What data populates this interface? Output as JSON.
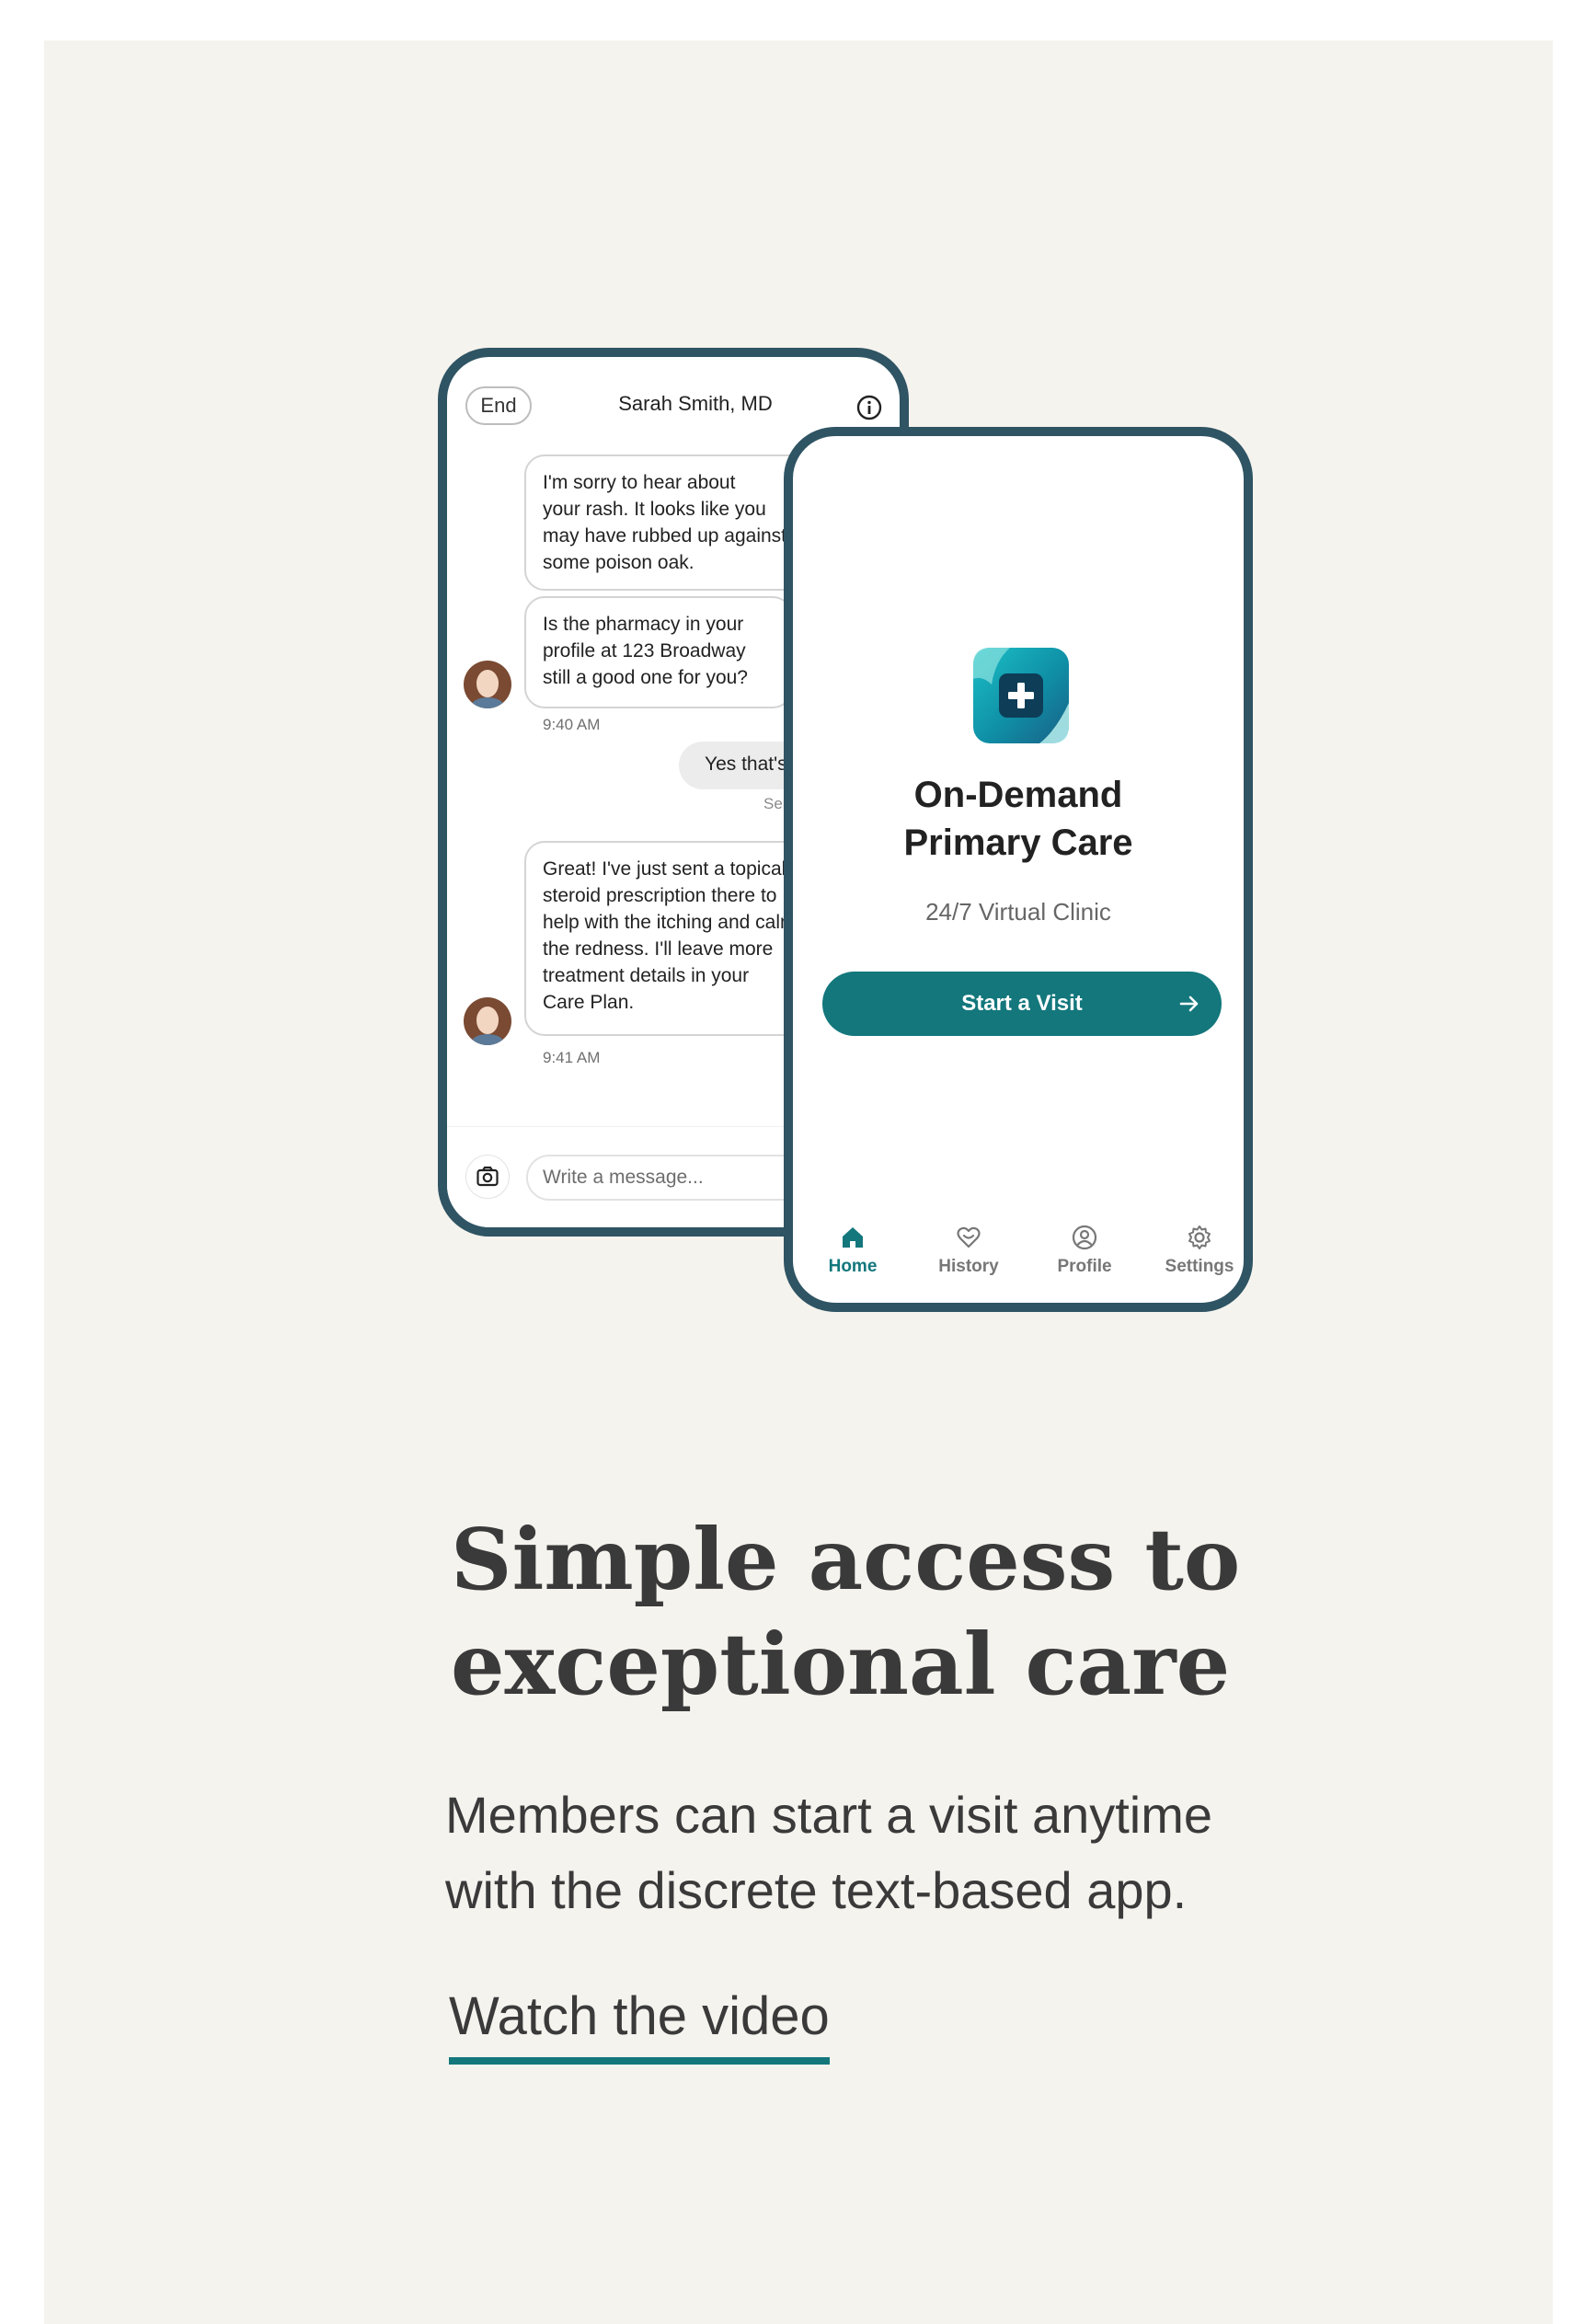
{
  "chat_phone": {
    "end_label": "End",
    "doctor_name": "Sarah Smith, MD",
    "messages": [
      {
        "lines": [
          "I'm sorry to hear about",
          "your rash. It looks like you",
          "may have rubbed up against",
          "some poison oak."
        ]
      },
      {
        "lines": [
          "Is the pharmacy in your",
          "profile at 123 Broadway",
          "still a good one for you?"
        ],
        "time": "9:40 AM"
      },
      {
        "text": "Yes that's",
        "status": "Sent"
      },
      {
        "lines": [
          "Great! I've just sent a topical",
          "steroid prescription there to",
          "help with the itching and calm",
          "the redness. I'll leave more",
          "treatment details in your",
          "Care Plan."
        ],
        "time": "9:41 AM"
      }
    ],
    "composer_placeholder": "Write a message..."
  },
  "home_phone": {
    "title_line1": "On-Demand",
    "title_line2": "Primary Care",
    "subtitle": "24/7 Virtual Clinic",
    "cta_label": "Start a Visit",
    "tabs": [
      {
        "label": "Home",
        "icon": "home-icon",
        "active": true
      },
      {
        "label": "History",
        "icon": "heart-chat-icon",
        "active": false
      },
      {
        "label": "Profile",
        "icon": "user-circle-icon",
        "active": false
      },
      {
        "label": "Settings",
        "icon": "gear-icon",
        "active": false
      }
    ]
  },
  "marketing": {
    "headline_line1": "Simple access to",
    "headline_line2": "exceptional care",
    "body_line1": "Members can start a visit anytime",
    "body_line2": "with the discrete text-based app.",
    "link_label": "Watch the video"
  },
  "colors": {
    "background": "#f5f3ee",
    "phone_frame": "#2f5463",
    "accent": "#13777c"
  }
}
